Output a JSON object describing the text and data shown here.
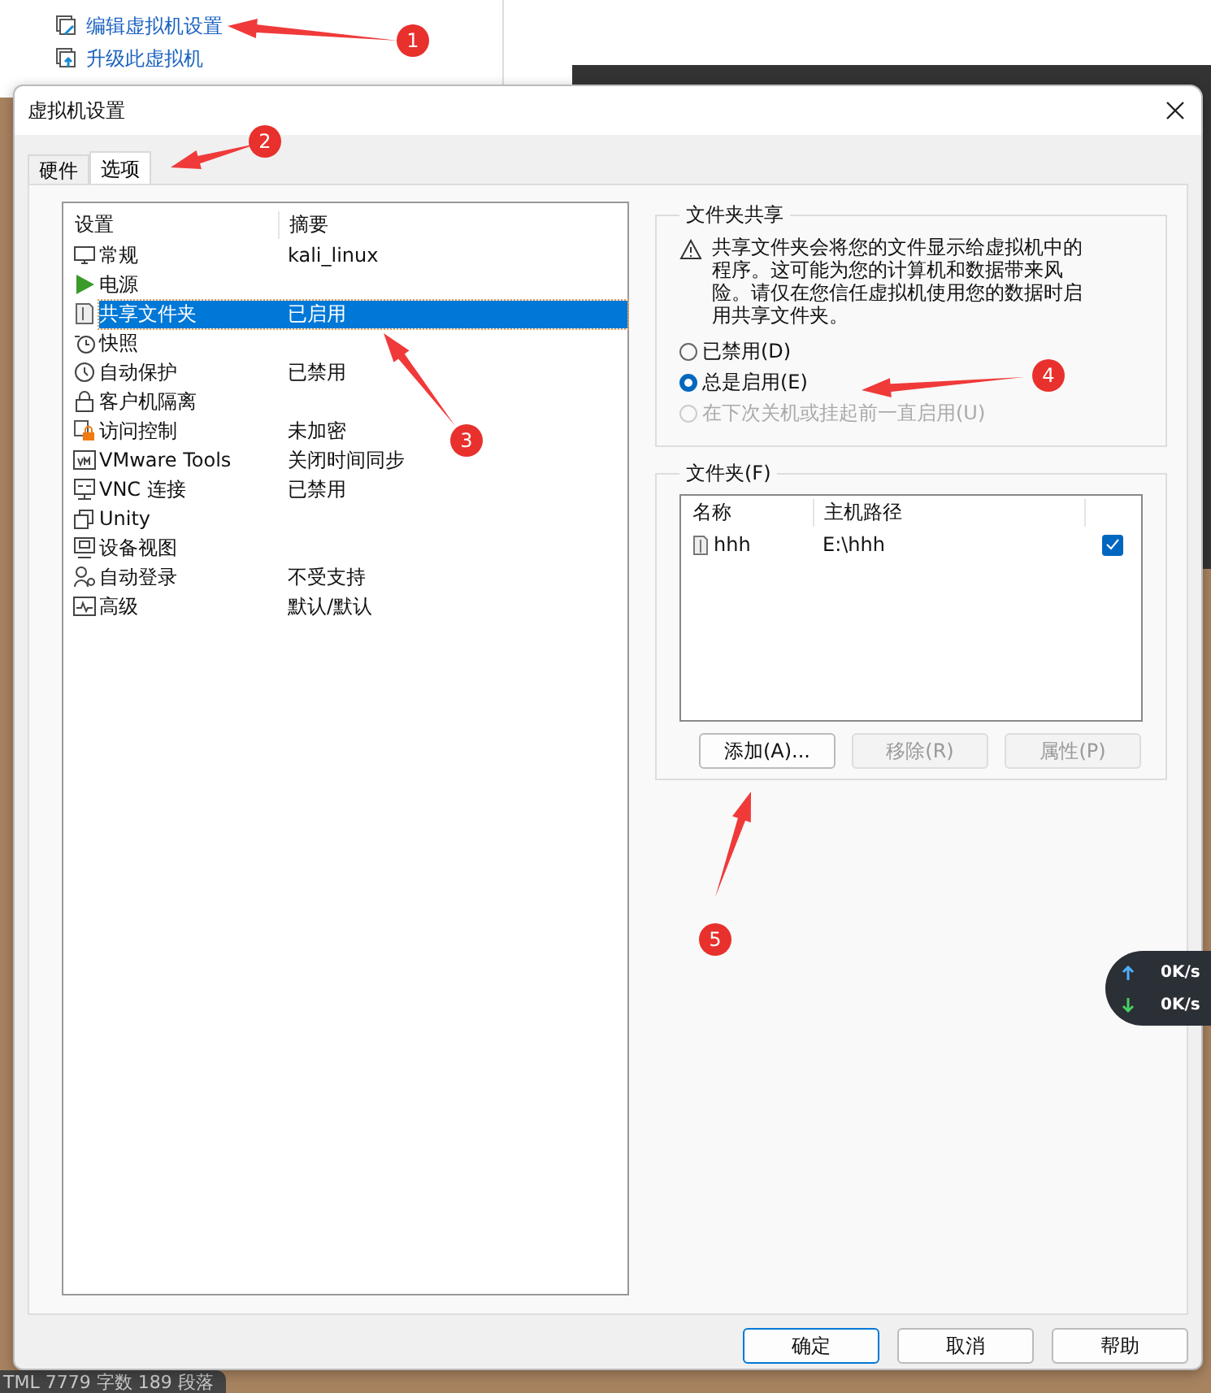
{
  "background_window": {
    "links": [
      {
        "label": "编辑虚拟机设置"
      },
      {
        "label": "升级此虚拟机"
      }
    ],
    "status_text": "TML  7779 字数  189 段落"
  },
  "dialog": {
    "title": "虚拟机设置",
    "tabs": [
      {
        "label": "硬件",
        "selected": false
      },
      {
        "label": "选项",
        "selected": true
      }
    ],
    "settings_list": {
      "columns": [
        "设置",
        "摘要"
      ],
      "rows": [
        {
          "name": "常规",
          "summary": "kali_linux",
          "selected": false
        },
        {
          "name": "电源",
          "selected": false
        },
        {
          "name": "共享文件夹",
          "summary": "已启用",
          "selected": true
        },
        {
          "name": "快照",
          "selected": false
        },
        {
          "name": "自动保护",
          "summary": "已禁用",
          "selected": false
        },
        {
          "name": "客户机隔离",
          "selected": false
        },
        {
          "name": "访问控制",
          "summary": "未加密",
          "selected": false
        },
        {
          "name": "VMware Tools",
          "summary": "关闭时间同步",
          "selected": false
        },
        {
          "name": "VNC 连接",
          "summary": "已禁用",
          "selected": false
        },
        {
          "name": "Unity",
          "selected": false
        },
        {
          "name": "设备视图",
          "selected": false
        },
        {
          "name": "自动登录",
          "summary": "不受支持",
          "selected": false
        },
        {
          "name": "高级",
          "summary": "默认/默认",
          "selected": false
        }
      ]
    },
    "sharing": {
      "title": "文件夹共享",
      "warning": "共享文件夹会将您的文件显示给虚拟机中的程序。这可能为您的计算机和数据带来风险。请仅在您信任虚拟机使用您的数据时启用共享文件夹。",
      "options": [
        {
          "label": "已禁用(D)",
          "selected": false,
          "disabled": false
        },
        {
          "label": "总是启用(E)",
          "selected": true,
          "disabled": false
        },
        {
          "label": "在下次关机或挂起前一直启用(U)",
          "selected": false,
          "disabled": true
        }
      ]
    },
    "folders": {
      "title": "文件夹(F)",
      "columns": [
        "名称",
        "主机路径"
      ],
      "rows": [
        {
          "name": "hhh",
          "path": "E:\\hhh",
          "checked": true
        }
      ],
      "buttons": [
        {
          "label": "添加(A)...",
          "disabled": false
        },
        {
          "label": "移除(R)",
          "disabled": true
        },
        {
          "label": "属性(P)",
          "disabled": true
        }
      ]
    },
    "buttons": [
      {
        "label": "确定",
        "default": true
      },
      {
        "label": "取消",
        "default": false
      },
      {
        "label": "帮助",
        "default": false
      }
    ]
  },
  "network_widget": {
    "readings": [
      "0K/s",
      "0K/s"
    ]
  },
  "annotations": [
    {
      "label": "1"
    },
    {
      "label": "2"
    },
    {
      "label": "3"
    },
    {
      "label": "4"
    },
    {
      "label": "5"
    }
  ]
}
